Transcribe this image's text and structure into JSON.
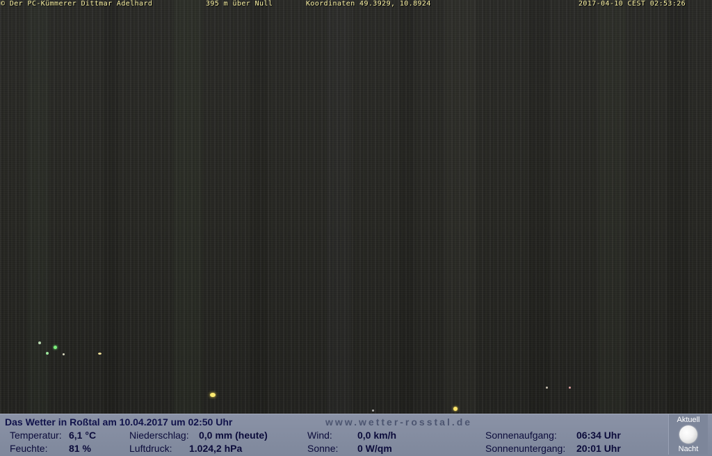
{
  "overlay": {
    "copyright": "© Der PC-Kümmerer Dittmar Adelhard",
    "altitude": "395 m über Null",
    "coordinates": "Koordinaten 49.3929, 10.8924",
    "datetime": "2017-04-10 CEST 02:53:26"
  },
  "weather": {
    "title": "Das Wetter in Roßtal am 10.04.2017 um 02:50 Uhr",
    "url": "www.wetter-rosstal.de",
    "temperature_label": "Temperatur:",
    "temperature_value": "6,1 °C",
    "humidity_label": "Feuchte:",
    "humidity_value": "81 %",
    "precip_label": "Niederschlag:",
    "precip_value": "0,0 mm (heute)",
    "pressure_label": "Luftdruck:",
    "pressure_value": "1.024,2 hPa",
    "wind_label": "Wind:",
    "wind_value": "0,0 km/h",
    "sun_label": "Sonne:",
    "sun_value": "0 W/qm",
    "sunrise_label": "Sonnenaufgang:",
    "sunrise_value": "06:34 Uhr",
    "sunset_label": "Sonnenuntergang:",
    "sunset_value": "20:01 Uhr"
  },
  "moon": {
    "top_label": "Aktuell",
    "bottom_label": "Nacht",
    "icon": "moon-icon"
  },
  "colors": {
    "overlay_text": "#fff7a8",
    "panel_bg": "#8a92a6",
    "panel_text": "#0b0b3a"
  }
}
